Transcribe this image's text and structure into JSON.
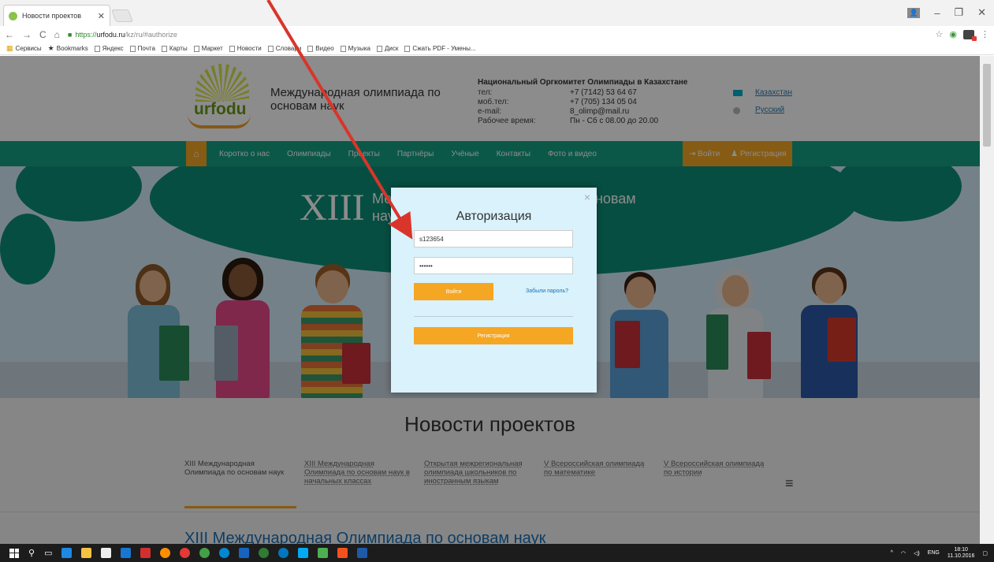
{
  "browser": {
    "tab_title": "Новости проектов",
    "url": {
      "scheme": "https://",
      "host": "urfodu.ru",
      "path": "/kz/ru/#authorize"
    },
    "bookmarks": [
      "Сервисы",
      "Bookmarks",
      "Яндекс",
      "Почта",
      "Карты",
      "Маркет",
      "Новости",
      "Словари",
      "Видео",
      "Музыка",
      "Диск",
      "Сжать PDF - Умены..."
    ]
  },
  "header": {
    "logo_text": "urfodu",
    "site_name": "Международная олимпиада по основам наук",
    "org": "Национальный Оргкомитет Олимпиады в Казахстане",
    "contacts": [
      {
        "label": "тел:",
        "value": "+7 (7142) 53 64 67"
      },
      {
        "label": "моб.тел:",
        "value": "+7 (705) 134 05 04"
      },
      {
        "label": "e-mail:",
        "value": "8_olimp@mail.ru"
      },
      {
        "label": "Рабочее время:",
        "value": "Пн - Сб с 08.00 до 20.00"
      }
    ],
    "languages": [
      "Казахстан",
      "Русский"
    ]
  },
  "nav": {
    "items": [
      "Коротко о нас",
      "Олимпиады",
      "Проекты",
      "Партнёры",
      "Учёные",
      "Контакты",
      "Фото и видео"
    ],
    "login": "Войти",
    "register": "Регистрация"
  },
  "hero": {
    "title": "XIII",
    "subtitle": "Международная олимпиада по основам наук"
  },
  "news": {
    "title": "Новости проектов",
    "tabs": [
      "XIII Международная Олимпиада по основам наук",
      "XIII Международная Олимпиада по основам наук в начальных классах",
      "Открытая межрегиональная олимпиада школьников по иностранным языкам",
      "V Всероссийская олимпиада по математике",
      "V Всероссийская олимпиада по истории"
    ],
    "heading": "XIII Международная Олимпиада по основам наук"
  },
  "modal": {
    "title": "Авторизация",
    "login_value": "s123654",
    "password_value": "••••••",
    "login_button": "Войти",
    "forgot": "Забыли пароль?",
    "register_button": "Регистрация"
  },
  "taskbar": {
    "lang": "ENG",
    "time": "18:10",
    "date": "11.10.2016"
  },
  "colors": {
    "accent_orange": "#f5a623",
    "nav_green": "#14a085",
    "link_blue": "#1a6fb5",
    "arrow_red": "#d9352b"
  }
}
